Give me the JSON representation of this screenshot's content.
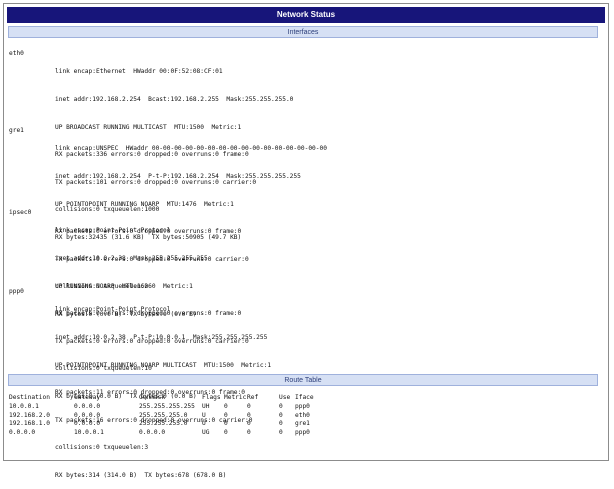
{
  "title": "Network Status",
  "interfaces_header": "Interfaces",
  "route_header": "Route Table",
  "interfaces": [
    {
      "name": "eth0",
      "lines": [
        "link encap:Ethernet  HWaddr 00:0F:52:08:CF:01",
        "inet addr:192.168.2.254  Bcast:192.168.2.255  Mask:255.255.255.0",
        "UP BROADCAST RUNNING MULTICAST  MTU:1500  Metric:1",
        "RX packets:336 errors:0 dropped:0 overruns:0 frame:0",
        "TX packets:101 errors:0 dropped:0 overruns:0 carrier:0",
        "collisions:0 txqueuelen:1000",
        "RX bytes:32435 (31.6 KB)  TX bytes:50905 (49.7 KB)"
      ]
    },
    {
      "name": "gre1",
      "lines": [
        "link encap:UNSPEC  HWaddr 00-00-00-00-00-00-00-00-00-00-00-00-00-00-00-00",
        "inet addr:192.168.2.254  P-t-P:192.168.2.254  Mask:255.255.255.255",
        "UP POINTOPOINT RUNNING NOARP  MTU:1476  Metric:1",
        "RX packets:0 errors:0 dropped:0 overruns:0 frame:0",
        "TX packets:0 errors:0 dropped:0 overruns:0 carrier:0",
        "collisions:0 txqueuelen:0",
        "RX bytes:0 (0.0 B)  TX bytes:0 (0.0 B)"
      ]
    },
    {
      "name": "ipsec0",
      "lines": [
        "link encap:Point-Point Protocol",
        "inet addr:10.0.2.38  Mask:255.255.255.255",
        "UP RUNNING NOARP  MTU:16260  Metric:1",
        "RX packets:0 errors:0 dropped:0 overruns:0 frame:0",
        "TX packets:0 errors:0 dropped:0 overruns:0 carrier:0",
        "collisions:0 txqueuelen:10",
        "RX bytes:0 (0.0 B)  TX bytes:0 (0.0 B)"
      ]
    },
    {
      "name": "ppp0",
      "lines": [
        "link encap:Point-Point Protocol",
        "inet addr:10.0.2.38  P-t-P:10.0.0.1  Mask:255.255.255.255",
        "UP POINTOPOINT RUNNING NOARP MULTICAST  MTU:1500  Metric:1",
        "RX packets:11 errors:0 dropped:0 overruns:0 frame:0",
        "TX packets:16 errors:0 dropped:0 overruns:0 carrier:0",
        "collisions:0 txqueuelen:3",
        "RX bytes:314 (314.0 B)  TX bytes:678 (678.0 B)"
      ]
    }
  ],
  "route_table": {
    "columns": [
      "Destination",
      "Gateway",
      "Genmask",
      "Flags",
      "Metric",
      "Ref",
      "Use",
      "Iface"
    ],
    "rows": [
      [
        "10.0.0.1",
        "0.0.0.0",
        "255.255.255.255",
        "UH",
        "0",
        "0",
        "0",
        "ppp0"
      ],
      [
        "192.168.2.0",
        "0.0.0.0",
        "255.255.255.0",
        "U",
        "0",
        "0",
        "0",
        "eth0"
      ],
      [
        "192.168.1.0",
        "0.0.0.0",
        "255.255.255.0",
        "U",
        "0",
        "0",
        "0",
        "gre1"
      ],
      [
        "0.0.0.0",
        "10.0.0.1",
        "0.0.0.0",
        "UG",
        "0",
        "0",
        "0",
        "ppp0"
      ]
    ]
  },
  "colors": {
    "title_bar": "#17157a",
    "section_bar": "#d6e0f4"
  }
}
